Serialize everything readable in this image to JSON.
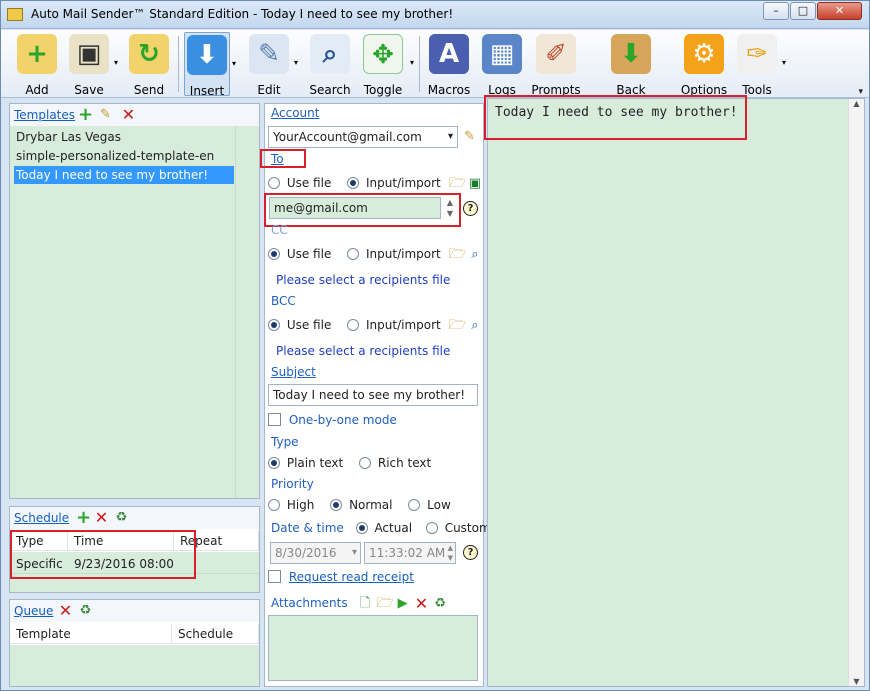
{
  "window": {
    "title": "Auto Mail Sender™ Standard Edition - Today I need to see my brother!",
    "minimize": "–",
    "maximize": "□",
    "close": "✕"
  },
  "toolbar": {
    "add": "Add",
    "save": "Save",
    "send": "Send",
    "insert": "Insert",
    "edit": "Edit",
    "search": "Search",
    "toggle": "Toggle",
    "macros": "Macros",
    "logs": "Logs",
    "prompts": "Prompts",
    "backup": "Back up/restore",
    "options": "Options",
    "tools": "Tools"
  },
  "templates": {
    "title": "Templates",
    "items": [
      "Drybar Las Vegas",
      "simple-personalized-template-en",
      "Today I need to see my brother!"
    ],
    "selected_index": 2
  },
  "schedule": {
    "title": "Schedule",
    "columns": [
      "Type",
      "Time",
      "Repeat"
    ],
    "rows": [
      {
        "type": "Specific",
        "time": "9/23/2016 08:00",
        "repeat": ""
      }
    ]
  },
  "queue": {
    "title": "Queue",
    "columns": [
      "Template",
      "Schedule"
    ]
  },
  "form": {
    "account_label": "Account",
    "account_value": "YourAccount@gmail.com",
    "to_label": "To",
    "to_use_file": "Use file",
    "to_input_import": "Input/import",
    "to_value": "me@gmail.com",
    "cc_label": "CC",
    "cc_use_file": "Use file",
    "cc_input_import": "Input/import",
    "cc_hint": "Please select a recipients file",
    "bcc_label": "BCC",
    "bcc_use_file": "Use file",
    "bcc_input_import": "Input/import",
    "bcc_hint": "Please select a recipients file",
    "subject_label": "Subject",
    "subject_value": "Today I need to see my brother!",
    "one_by_one": "One-by-one mode",
    "type_label": "Type",
    "type_plain": "Plain text",
    "type_rich": "Rich text",
    "priority_label": "Priority",
    "priority_high": "High",
    "priority_normal": "Normal",
    "priority_low": "Low",
    "datetime_label": "Date & time",
    "datetime_actual": "Actual",
    "datetime_custom": "Custom",
    "date_value": "8/30/2016",
    "time_value": "11:33:02 AM",
    "read_receipt": "Request read receipt",
    "attachments_label": "Attachments"
  },
  "body": {
    "text": "Today I need to see my brother!"
  },
  "icons": {
    "help": "?",
    "dropdown": "▾"
  }
}
